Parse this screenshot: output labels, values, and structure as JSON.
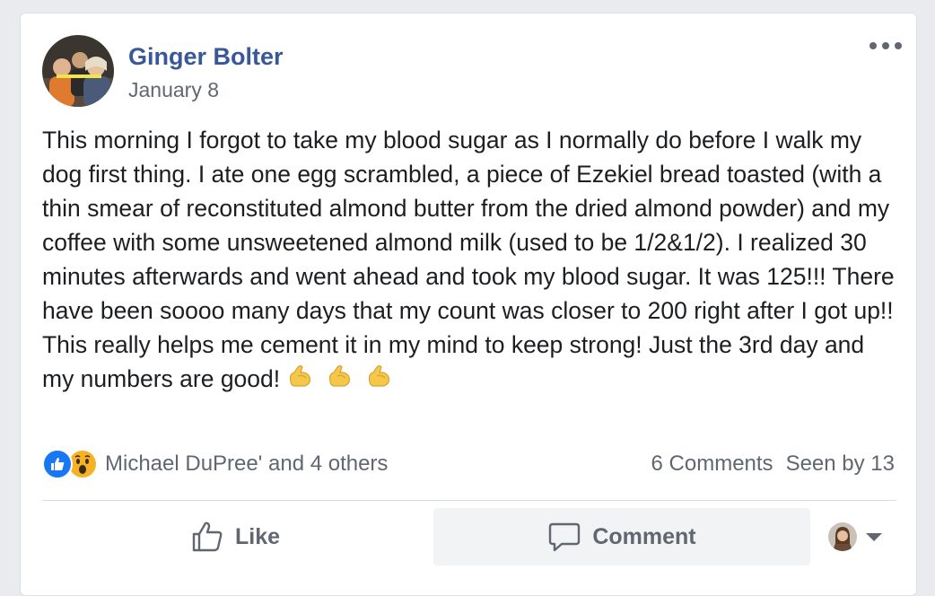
{
  "post": {
    "author": "Ginger Bolter",
    "date": "January 8",
    "text": "This morning I forgot to take my blood sugar as I normally do before I walk my dog first thing. I ate one egg scrambled, a piece of Ezekiel bread toasted (with a thin smear of reconstituted almond butter from the dried almond powder) and my coffee with some unsweetened almond milk (used to be 1/2&1/2). I realized 30 minutes afterwards and went ahead and took my blood sugar. It was 125!!! There have been soooo many days that my count was closer to 200 right after I got up!! This really helps me cement it in my mind to keep strong! Just the 3rd day and my numbers are good!",
    "emojis": [
      "💪",
      "💪",
      "💪"
    ]
  },
  "reactions": {
    "icons": [
      "like-icon",
      "wow-icon"
    ],
    "summary": "Michael DuPree' and 4 others",
    "comments": "6 Comments",
    "seen_by": "Seen by 13"
  },
  "actions": {
    "like_label": "Like",
    "comment_label": "Comment"
  },
  "colors": {
    "author_link": "#385898",
    "like_blue": "#1877f2",
    "wow_yellow": "#f7b125",
    "muted_text": "#606770"
  }
}
